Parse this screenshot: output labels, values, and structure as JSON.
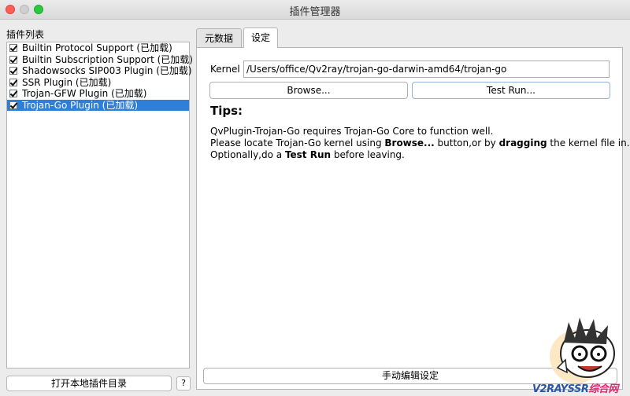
{
  "window": {
    "title": "插件管理器"
  },
  "left": {
    "heading": "插件列表",
    "plugins": [
      {
        "label": "Builtin Protocol Support (已加载)",
        "checked": true,
        "selected": false
      },
      {
        "label": "Builtin Subscription Support (已加载)",
        "checked": true,
        "selected": false
      },
      {
        "label": "Shadowsocks SIP003 Plugin (已加载)",
        "checked": true,
        "selected": false
      },
      {
        "label": "SSR Plugin (已加载)",
        "checked": true,
        "selected": false
      },
      {
        "label": "Trojan-GFW Plugin (已加载)",
        "checked": true,
        "selected": false
      },
      {
        "label": "Trojan-Go Plugin (已加载)",
        "checked": true,
        "selected": true
      }
    ],
    "open_dir_button": "打开本地插件目录",
    "help_button": "?"
  },
  "tabs": [
    {
      "label": "元数据",
      "active": false
    },
    {
      "label": "设定",
      "active": true
    }
  ],
  "settings": {
    "kernel_label": "Kernel",
    "kernel_value": "/Users/office/Qv2ray/trojan-go-darwin-amd64/trojan-go",
    "browse_button": "Browse...",
    "test_button": "Test Run...",
    "tips_title": "Tips:",
    "tips": {
      "line1": "QvPlugin-Trojan-Go requires Trojan-Go Core to function well.",
      "line2_a": "Please locate Trojan-Go kernel using ",
      "line2_b": "Browse...",
      "line2_c": " button,or by ",
      "line2_d": "dragging",
      "line2_e": " the kernel file in.",
      "line3_a": "Optionally,do a ",
      "line3_b": "Test Run",
      "line3_c": " before leaving."
    },
    "manual_edit_button": "手动编辑设定"
  },
  "watermark": {
    "brand": "V2RAYSSR",
    "suffix": "综合网"
  },
  "colors": {
    "selection": "#2f7ed8",
    "close": "#fe5f57",
    "maximize": "#2bc840"
  }
}
